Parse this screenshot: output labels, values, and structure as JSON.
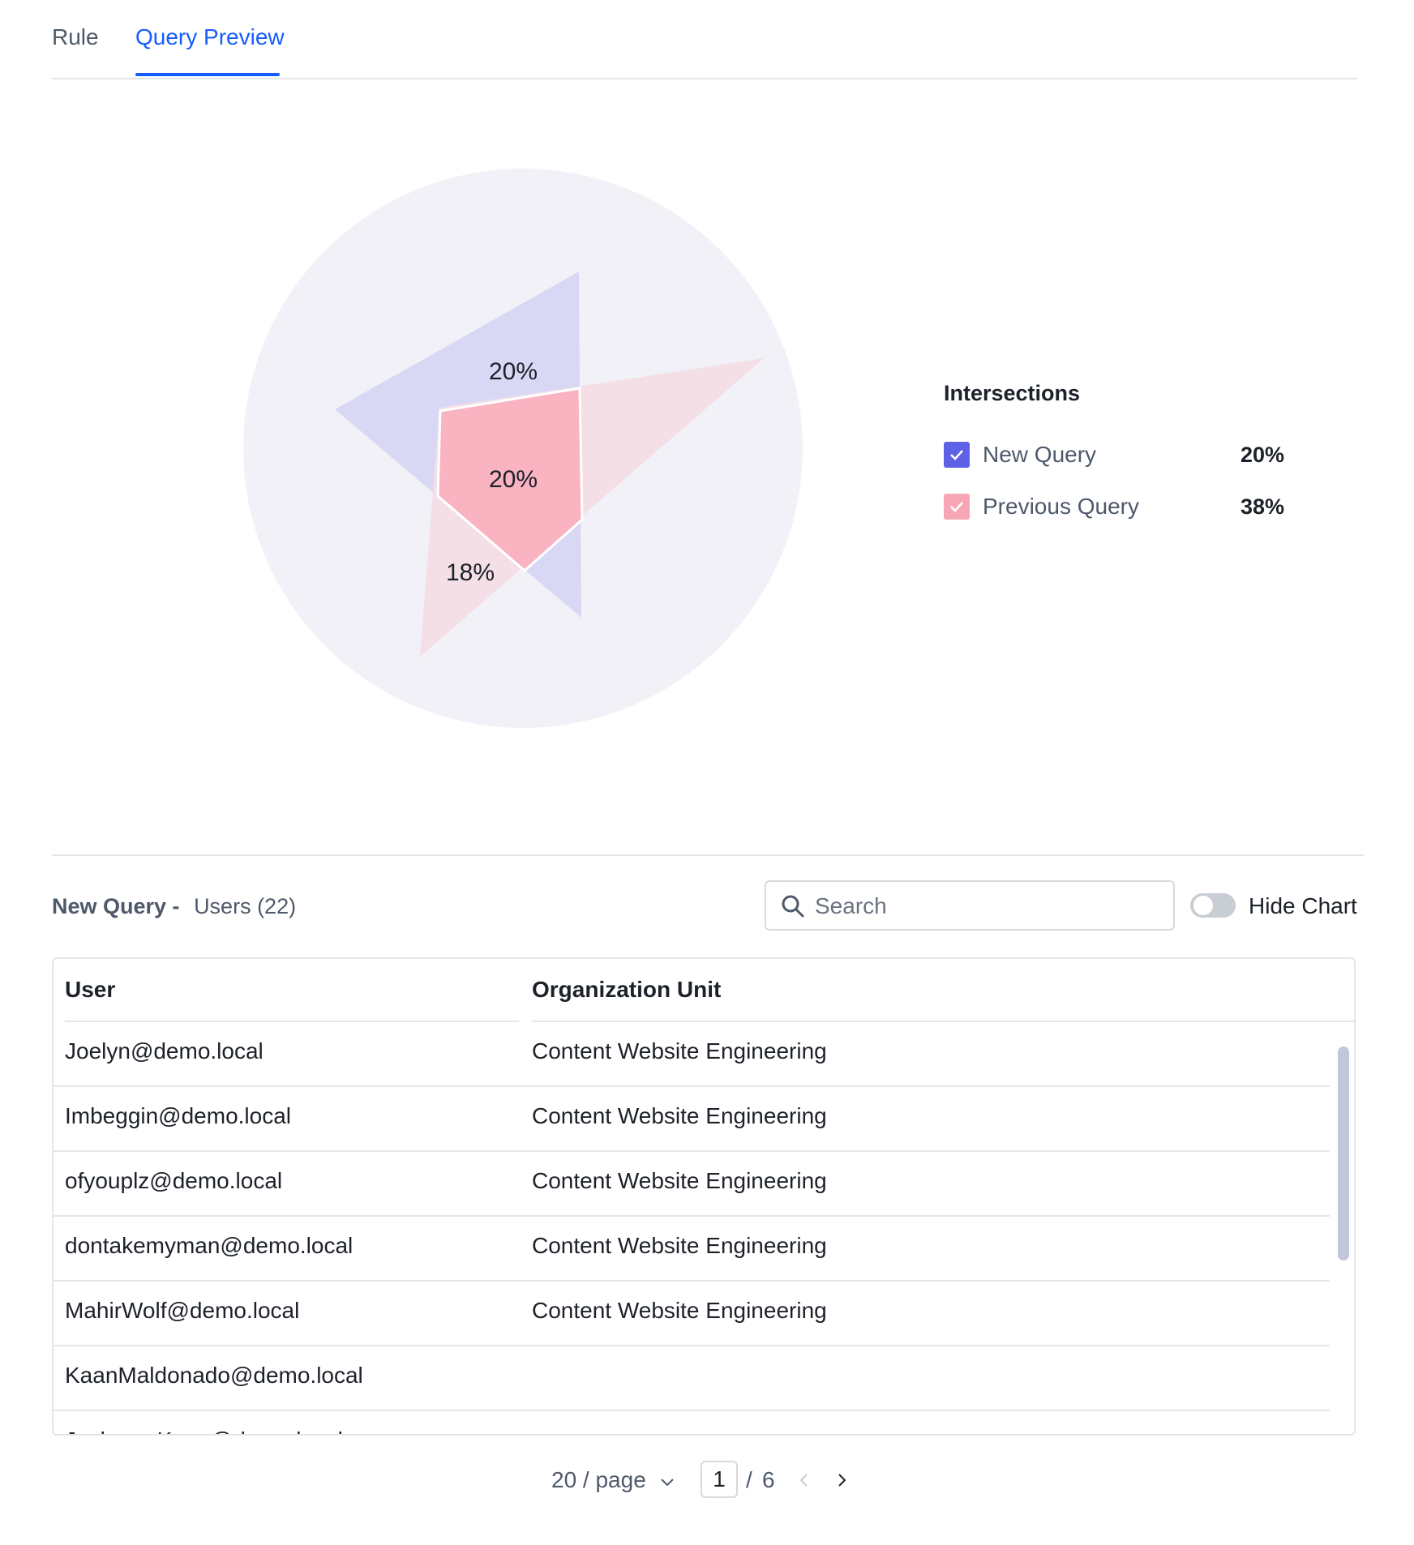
{
  "tabs": [
    {
      "label": "Rule",
      "active": false
    },
    {
      "label": "Query Preview",
      "active": true
    }
  ],
  "chart_data": {
    "type": "other",
    "labels": [
      "20%",
      "20%",
      "18%"
    ],
    "colors": {
      "background": "#f1f1f7",
      "new_query": "#d9d8f4",
      "previous_query": "#f3dfe5",
      "overlap": "#f9b3c1"
    }
  },
  "legend": {
    "title": "Intersections",
    "items": [
      {
        "label": "New Query",
        "value": "20%",
        "color": "#5e60e6",
        "icon": "check-icon"
      },
      {
        "label": "Previous Query",
        "value": "38%",
        "color": "#f7a6b6",
        "icon": "check-icon"
      }
    ]
  },
  "list": {
    "title": "New Query -",
    "subtitle": "Users (22)",
    "search_placeholder": "Search",
    "toggle_label": "Hide Chart"
  },
  "table": {
    "columns": [
      "User",
      "Organization Unit"
    ],
    "rows": [
      {
        "user": "Joelyn@demo.local",
        "org": "Content Website Engineering"
      },
      {
        "user": "Imbeggin@demo.local",
        "org": "Content Website Engineering"
      },
      {
        "user": "ofyouplz@demo.local",
        "org": "Content Website Engineering"
      },
      {
        "user": "dontakemyman@demo.local",
        "org": "Content Website Engineering"
      },
      {
        "user": "MahirWolf@demo.local",
        "org": "Content Website Engineering"
      },
      {
        "user": "KaanMaldonado@demo.local",
        "org": ""
      },
      {
        "user": "JaskaranKane@demo.local",
        "org": ""
      }
    ]
  },
  "pagination": {
    "page_size": "20 / page",
    "current_page": "1",
    "separator": "/",
    "total_pages": "6"
  }
}
